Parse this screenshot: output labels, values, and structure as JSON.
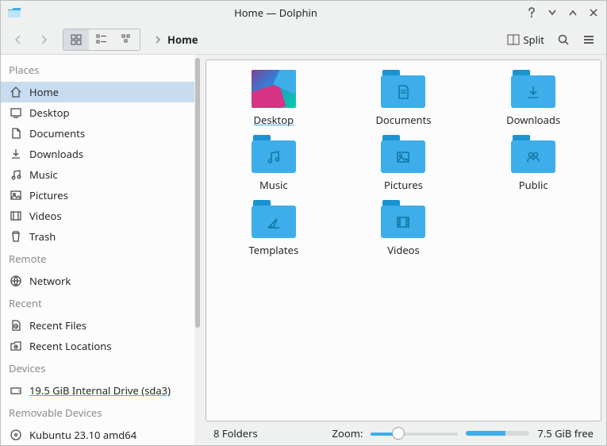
{
  "window": {
    "title": "Home — Dolphin"
  },
  "toolbar": {
    "split_label": "Split",
    "breadcrumb": [
      {
        "label": "Home",
        "current": true
      }
    ]
  },
  "sidebar": {
    "sections": [
      {
        "title": "Places",
        "items": [
          {
            "icon": "home",
            "label": "Home",
            "selected": true
          },
          {
            "icon": "desktop",
            "label": "Desktop"
          },
          {
            "icon": "documents",
            "label": "Documents"
          },
          {
            "icon": "downloads",
            "label": "Downloads"
          },
          {
            "icon": "music",
            "label": "Music"
          },
          {
            "icon": "pictures",
            "label": "Pictures"
          },
          {
            "icon": "videos",
            "label": "Videos"
          },
          {
            "icon": "trash",
            "label": "Trash"
          }
        ]
      },
      {
        "title": "Remote",
        "items": [
          {
            "icon": "network",
            "label": "Network"
          }
        ]
      },
      {
        "title": "Recent",
        "items": [
          {
            "icon": "recent-files",
            "label": "Recent Files"
          },
          {
            "icon": "recent-locations",
            "label": "Recent Locations"
          }
        ]
      },
      {
        "title": "Devices",
        "items": [
          {
            "icon": "drive",
            "label": "19.5 GiB Internal Drive (sda3)",
            "underline": true
          }
        ]
      },
      {
        "title": "Removable Devices",
        "items": [
          {
            "icon": "disc",
            "label": "Kubuntu 23.10 amd64"
          }
        ]
      }
    ]
  },
  "content": {
    "items": [
      {
        "name": "Desktop",
        "type": "thumb",
        "selected": true
      },
      {
        "name": "Documents",
        "type": "folder",
        "glyph": "documents"
      },
      {
        "name": "Downloads",
        "type": "folder",
        "glyph": "downloads"
      },
      {
        "name": "Music",
        "type": "folder",
        "glyph": "music"
      },
      {
        "name": "Pictures",
        "type": "folder",
        "glyph": "pictures"
      },
      {
        "name": "Public",
        "type": "folder",
        "glyph": "public"
      },
      {
        "name": "Templates",
        "type": "folder",
        "glyph": "templates"
      },
      {
        "name": "Videos",
        "type": "folder",
        "glyph": "videos"
      }
    ]
  },
  "status": {
    "count": "8 Folders",
    "zoom_label": "Zoom:",
    "free": "7.5 GiB free"
  }
}
